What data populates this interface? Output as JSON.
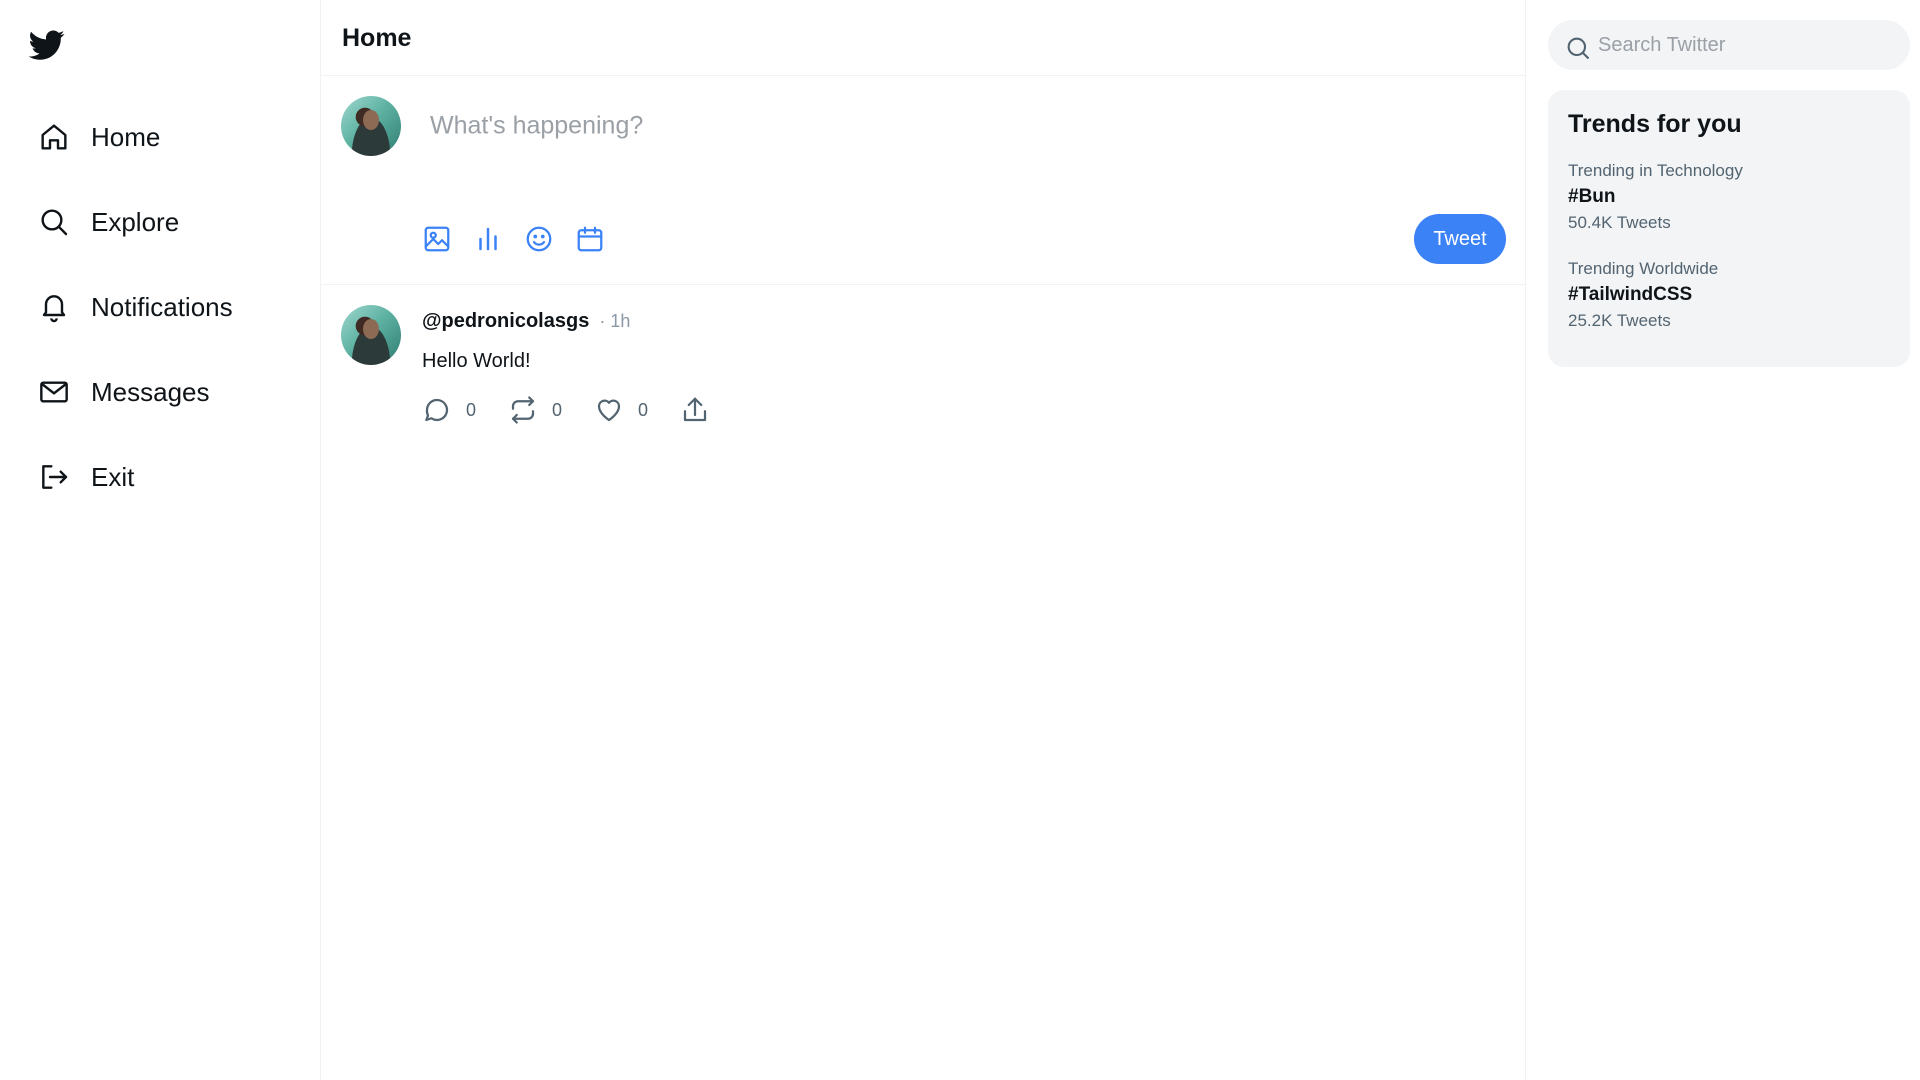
{
  "app": {
    "brand_color": "#3b82f6",
    "logo_icon": "twitter-bird-icon"
  },
  "sidebar": {
    "items": [
      {
        "label": "Home",
        "icon": "home-icon"
      },
      {
        "label": "Explore",
        "icon": "search-icon"
      },
      {
        "label": "Notifications",
        "icon": "bell-icon"
      },
      {
        "label": "Messages",
        "icon": "mail-icon"
      },
      {
        "label": "Exit",
        "icon": "logout-icon"
      }
    ]
  },
  "main": {
    "title": "Home",
    "composer": {
      "placeholder": "What's happening?",
      "tools": [
        "image-icon",
        "poll-icon",
        "emoji-icon",
        "schedule-icon"
      ],
      "submit_label": "Tweet"
    },
    "posts": [
      {
        "username": "@pedronicolasgs",
        "time": "· 1h",
        "text": "Hello World!",
        "replies": "0",
        "retweets": "0",
        "likes": "0"
      }
    ]
  },
  "right": {
    "search_placeholder": "Search Twitter",
    "trends_title": "Trends for you",
    "trends": [
      {
        "context": "Trending in Technology",
        "tag": "#Bun",
        "count": "50.4K Tweets"
      },
      {
        "context": "Trending Worldwide",
        "tag": "#TailwindCSS",
        "count": "25.2K Tweets"
      }
    ]
  }
}
